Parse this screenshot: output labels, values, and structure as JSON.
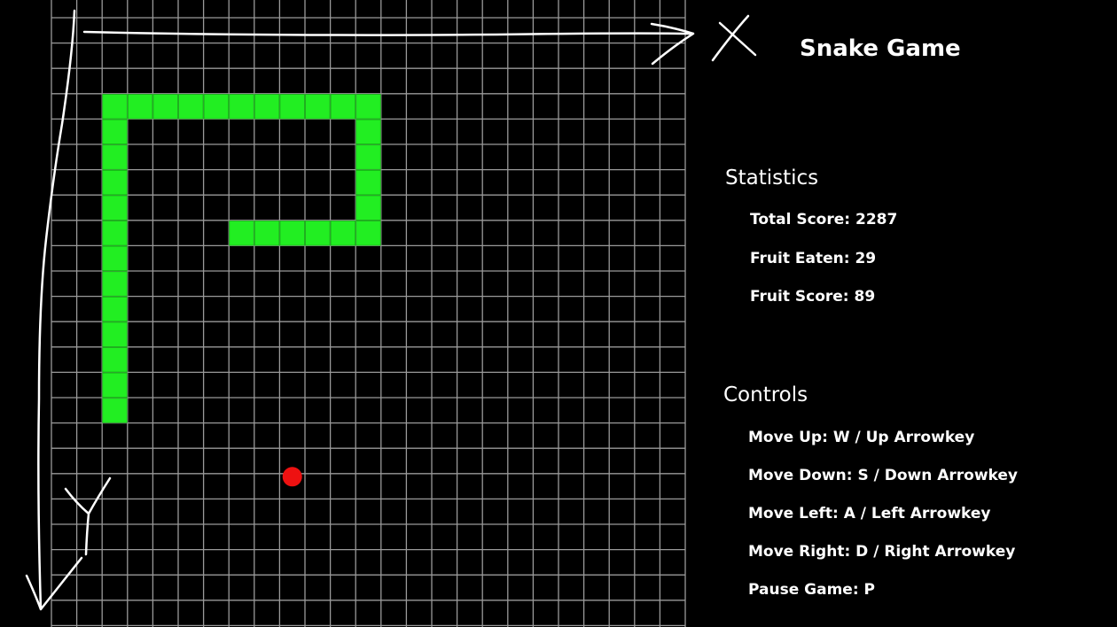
{
  "game": {
    "title": "Snake Game",
    "snake_color": "#22ee22",
    "fruit_color": "#ee1111",
    "grid_color": "#9a9a9a",
    "background_color": "#000000",
    "snake_cells": [
      [
        2,
        3
      ],
      [
        2,
        2
      ],
      [
        2,
        1
      ],
      [
        2,
        0
      ],
      [
        3,
        0
      ],
      [
        4,
        0
      ],
      [
        5,
        0
      ],
      [
        6,
        0
      ],
      [
        7,
        0
      ],
      [
        8,
        0
      ],
      [
        9,
        0
      ],
      [
        10,
        0
      ],
      [
        11,
        0
      ],
      [
        12,
        0
      ],
      [
        12,
        1
      ],
      [
        12,
        2
      ],
      [
        12,
        3
      ],
      [
        12,
        4
      ],
      [
        12,
        5
      ],
      [
        11,
        5
      ],
      [
        10,
        5
      ],
      [
        9,
        5
      ],
      [
        8,
        5
      ],
      [
        7,
        5
      ],
      [
        2,
        4
      ],
      [
        2,
        5
      ],
      [
        2,
        6
      ],
      [
        2,
        7
      ],
      [
        2,
        8
      ],
      [
        2,
        9
      ],
      [
        2,
        10
      ],
      [
        2,
        11
      ],
      [
        2,
        12
      ]
    ],
    "fruit_cell": [
      9,
      15
    ],
    "annotations": {
      "x_axis": "X",
      "y_axis": "Y"
    }
  },
  "statistics": {
    "heading": "Statistics",
    "total_score": "Total Score: 2287",
    "fruit_eaten": "Fruit Eaten: 29",
    "fruit_score": "Fruit Score: 89"
  },
  "controls": {
    "heading": "Controls",
    "items": [
      "Move Up: W / Up Arrowkey",
      "Move Down: S / Down Arrowkey",
      "Move Left: A / Left Arrowkey",
      "Move Right: D / Right Arrowkey",
      "Pause Game: P"
    ]
  }
}
